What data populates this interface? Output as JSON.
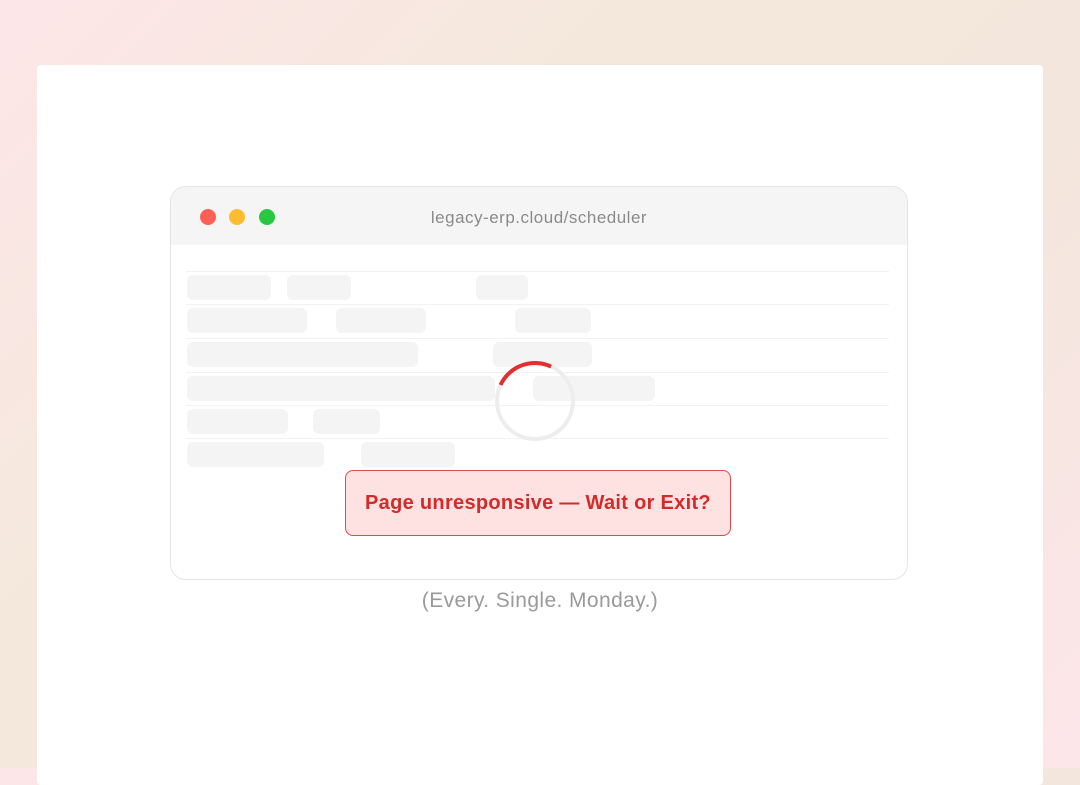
{
  "browser": {
    "url": "legacy-erp.cloud/scheduler",
    "window_controls": [
      "close",
      "minimize",
      "maximize"
    ]
  },
  "dialog": {
    "message": "Page unresponsive — Wait or Exit?"
  },
  "caption": "(Every. Single. Monday.)",
  "colors": {
    "alert_text": "#d42a2a",
    "alert_background": "#fee1e1",
    "spinner_accent": "#e03030"
  },
  "icons": {
    "loading": "loading-spinner-icon"
  }
}
